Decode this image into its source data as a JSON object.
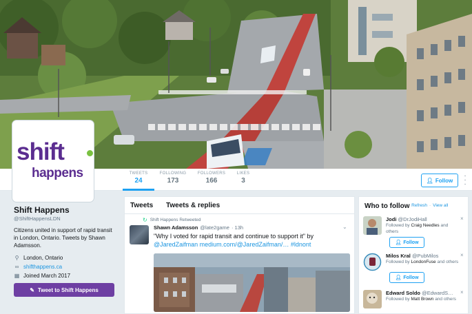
{
  "colors": {
    "accent": "#1da1f2",
    "brand_purple": "#5b2d90",
    "button_purple": "#6e3fa3",
    "brand_green": "#7ac142"
  },
  "avatar": {
    "logo_line1": "shift",
    "logo_line2": "happens"
  },
  "nav": {
    "stats": [
      {
        "label": "TWEETS",
        "value": "24",
        "active": true
      },
      {
        "label": "FOLLOWING",
        "value": "173",
        "active": false
      },
      {
        "label": "FOLLOWERS",
        "value": "166",
        "active": false
      },
      {
        "label": "LIKES",
        "value": "3",
        "active": false
      }
    ],
    "follow_label": "Follow",
    "more_icon": "kebab-icon"
  },
  "profile": {
    "name": "Shift Happens",
    "handle": "@ShiftHappensLDN",
    "bio": "Citizens united in support of rapid transit in London, Ontario. Tweets by Shawn Adamsson.",
    "location": "London, Ontario",
    "website": "shifthappens.ca",
    "joined": "Joined March 2017",
    "tweet_to_label": "Tweet to Shift Happens"
  },
  "timeline": {
    "tabs": [
      "Tweets",
      "Tweets & replies"
    ],
    "tweet": {
      "retweet_label": "Shift Happens Retweeted",
      "author_name": "Shawn Adamsson",
      "author_handle": "@late2game",
      "time": "· 13h",
      "text_before": "\"Why I voted for rapid transit and continue to support it\" by ",
      "text_mentions": "@JaredZaifman medium.com/@JaredZaifman/… #ldnont"
    }
  },
  "who_to_follow": {
    "title": "Who to follow",
    "refresh": "Refresh",
    "view_all": "View all",
    "separator": "·",
    "follow_label": "Follow",
    "suggestions": [
      {
        "name": "Jodi",
        "handle": "@DrJodiHall",
        "followed_prefix": "Followed by",
        "followed_by": "Craig Needles",
        "followed_suffix": "and others"
      },
      {
        "name": "Milos Kral",
        "handle": "@PubMilos",
        "followed_prefix": "Followed by",
        "followed_by": "LondonFuse",
        "followed_suffix": "and others"
      },
      {
        "name": "Edward Soldo",
        "handle": "@EdwardS…",
        "followed_prefix": "Followed by",
        "followed_by": "Matt Brown",
        "followed_suffix": "and others"
      }
    ]
  }
}
